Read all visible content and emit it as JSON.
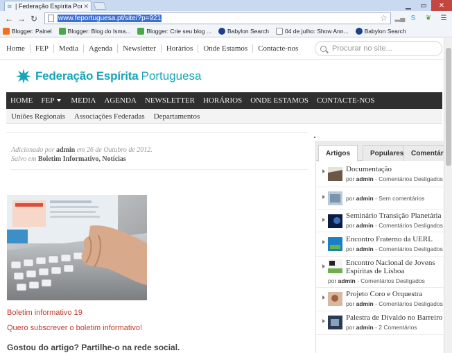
{
  "browser": {
    "tab_title": "| Federação Espírita Portugue",
    "url": "www.feportuguesa.pt/site/?p=921",
    "bookmarks": [
      {
        "label": "Blogger: Painel",
        "color": "#f37021"
      },
      {
        "label": "Blogger: Blog do Isma...",
        "color": "#4aa84a"
      },
      {
        "label": "Blogger: Crie seu blog ...",
        "color": "#4aa84a"
      },
      {
        "label": "Babylon Search",
        "color": "#1d3f8c"
      },
      {
        "label": "04 de julho: Show Ann...",
        "color": "#ffffff"
      },
      {
        "label": "Babylon Search",
        "color": "#1d3f8c"
      }
    ]
  },
  "site": {
    "top_nav": [
      "Home",
      "FEP",
      "Media",
      "Agenda",
      "Newsletter",
      "Horários",
      "Onde Estamos",
      "Contacte-nos"
    ],
    "search_placeholder": "Procurar no site...",
    "logo": {
      "bold": "Federação Espírita",
      "regular": "Portuguesa",
      "color": "#17a5b8"
    },
    "main_nav": [
      "HOME",
      "FEP",
      "MEDIA",
      "AGENDA",
      "NEWSLETTER",
      "HORÁRIOS",
      "ONDE ESTAMOS",
      "CONTACTE-NOS"
    ],
    "sub_nav": [
      "Uniões Regionais",
      "Associações Federadas",
      "Departamentos"
    ]
  },
  "post": {
    "meta_added_prefix": "Adicionado por",
    "author": "admin",
    "meta_date": "em 26 de Outubro de 2012.",
    "meta_saved_prefix": "Salvo em",
    "categories": "Boletim Informativo, Notícias",
    "link1": "Boletim informativo 19",
    "link2": "Quero subscrever o boletim informativo!",
    "share_heading": "Gostou do artigo? Partilhe-o na rede social."
  },
  "sidebar": {
    "tabs": [
      "Artigos",
      "Populares",
      "Comentários"
    ],
    "items": [
      {
        "title": "Documentação",
        "by": "por",
        "author": "admin",
        "comments": "Comentários Desligados"
      },
      {
        "title": "",
        "by": "por",
        "author": "admin",
        "comments": "Sem comentários"
      },
      {
        "title": "Seminário Transição Planetária",
        "by": "por",
        "author": "admin",
        "comments": "Comentários Desligados"
      },
      {
        "title": "Encontro Fraterno da UERL",
        "by": "por",
        "author": "admin",
        "comments": "Comentários Desligados"
      },
      {
        "title": "Encontro Nacional de Jovens",
        "title2": "Espíritas de Lisboa",
        "by": "por",
        "author": "admin",
        "comments": "Comentários Desligados"
      },
      {
        "title": "Projeto Coro e Orquestra",
        "by": "por",
        "author": "admin",
        "comments": "Comentários Desligados"
      },
      {
        "title": "Palestra de Divaldo no Barreiro",
        "by": "por",
        "author": "admin",
        "comments": "2 Comentários"
      }
    ]
  }
}
